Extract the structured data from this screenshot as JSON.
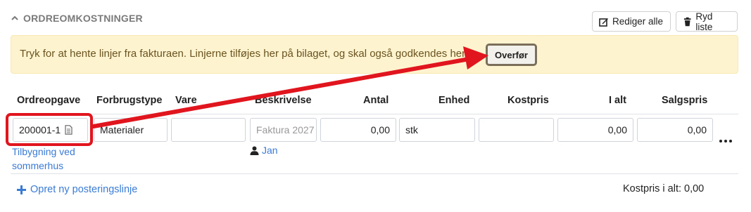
{
  "section": {
    "title": "ORDREOMKOSTNINGER",
    "collapse_icon": "chevron-up-icon"
  },
  "toolbar": {
    "edit_all_label": "Rediger alle",
    "clear_list_label": "Ryd liste"
  },
  "info_bar": {
    "text": "Tryk for at hente linjer fra fakturaen. Linjerne tilføjes her på bilaget, og skal også godkendes her",
    "transfer_label": "Overfør"
  },
  "table": {
    "headers": [
      "Ordreopgave",
      "Forbrugstype",
      "Vare",
      "Beskrivelse",
      "Antal",
      "Enhed",
      "Kostpris",
      "I alt",
      "Salgspris"
    ],
    "row": {
      "order_task": "200001-1",
      "order_task_name": "Tilbygning ved sommerhus",
      "consumption_type": "Materialer",
      "item": "",
      "description": "Faktura 2027",
      "user": "Jan",
      "quantity": "0,00",
      "unit": "stk",
      "cost_price": "",
      "total": "0,00",
      "sales_price": "0,00"
    }
  },
  "footer": {
    "add_line_label": "Opret ny posteringslinje",
    "cost_total_label": "Kostpris i alt: 0,00"
  },
  "colors": {
    "accent": "#3a7bd5",
    "highlight": "#e0151d",
    "info_bg": "#fdf4cf"
  }
}
